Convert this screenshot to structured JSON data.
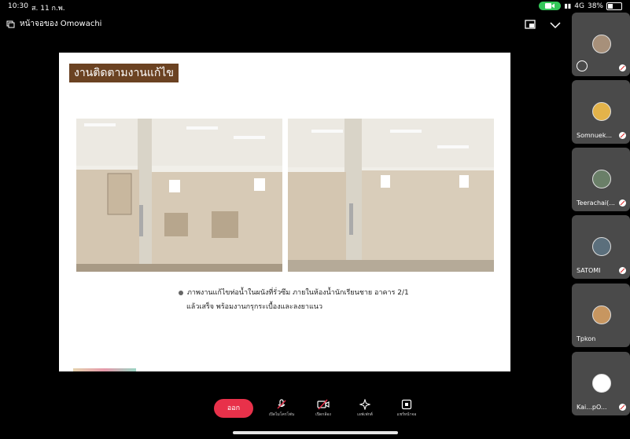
{
  "status": {
    "time": "10:30",
    "date": "ส. 11 ก.พ.",
    "network": "4G",
    "battery_percent": "38%",
    "camera_active_color": "#34c759"
  },
  "topbar": {
    "share_label": "หน้าจอของ Omowachi",
    "icons": [
      "screen-share-icon",
      "pip-icon",
      "chevron-down-icon"
    ]
  },
  "slide": {
    "title": "งานติดตามงานแก้ไข",
    "bullet_line_1": "ภาพงานแก้ไขท่อน้ำในผนังที่รั่วซึม ภายในห้องน้ำนักเรียนชาย อาคาร 2/1",
    "bullet_line_2": "แล้วเสร็จ พร้อมงานกรุกระเบื้องและลงยาแนว",
    "title_color": "#6b4222"
  },
  "participants": [
    {
      "name": "",
      "has_emoji": true
    },
    {
      "name": "Somnuek..."
    },
    {
      "name": "Teerachai(..."
    },
    {
      "name": "SATOMI"
    },
    {
      "name": "Tpkon"
    },
    {
      "name": "Kai...pO..."
    }
  ],
  "controls": {
    "leave_label": "ออก",
    "unmute_label": "เปิดไมโครโฟน",
    "camera_label": "เปิดกล้อง",
    "effects_label": "เอฟเฟกต์",
    "share_label": "แชร์หน้าจอ",
    "leave_color": "#e8314a"
  }
}
